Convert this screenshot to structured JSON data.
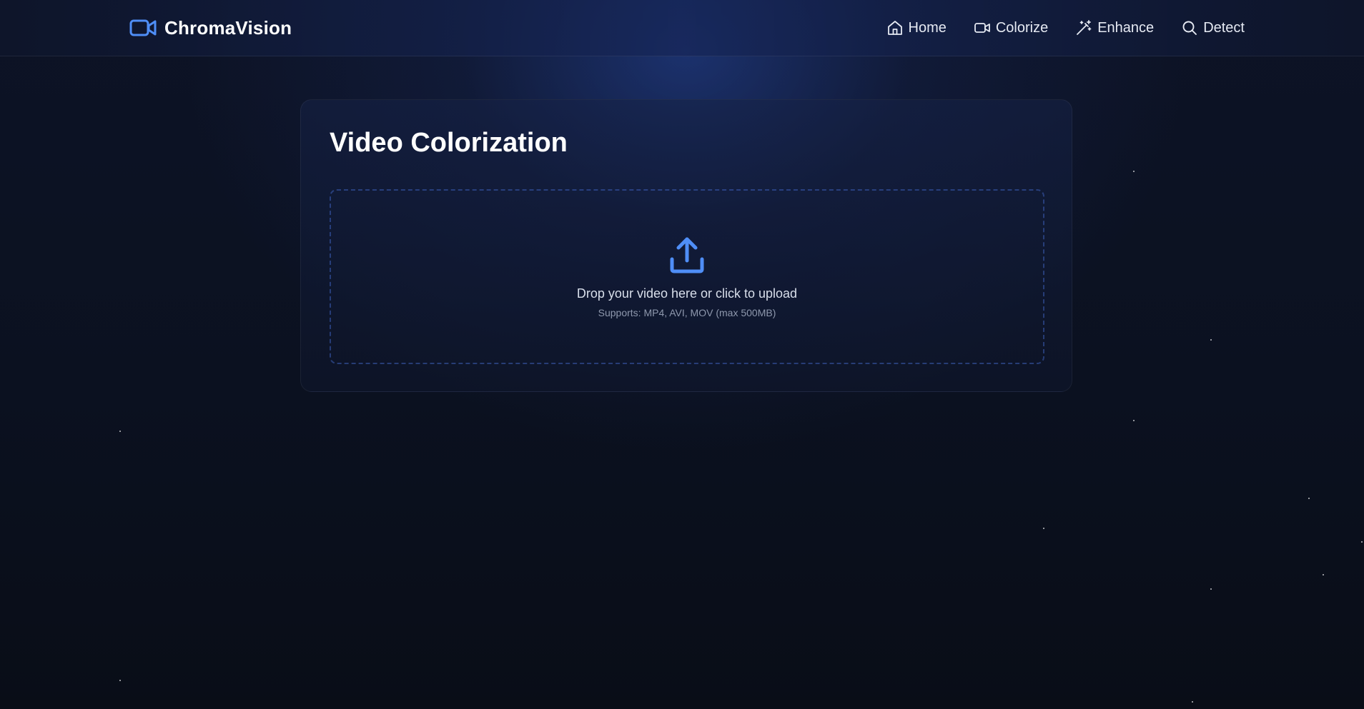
{
  "brand": {
    "name": "ChromaVision",
    "icon": "video-camera-icon",
    "accent_color": "#4f8ef7"
  },
  "nav": {
    "items": [
      {
        "label": "Home",
        "icon": "home-icon"
      },
      {
        "label": "Colorize",
        "icon": "video-camera-icon"
      },
      {
        "label": "Enhance",
        "icon": "magic-wand-icon"
      },
      {
        "label": "Detect",
        "icon": "search-icon"
      }
    ]
  },
  "main": {
    "title": "Video Colorization",
    "upload": {
      "icon": "upload-icon",
      "prompt": "Drop your video here or click to upload",
      "supports": "Supports: MP4, AVI, MOV (max 500MB)"
    }
  },
  "colors": {
    "background": "#0b1120",
    "accent": "#4f8ef7",
    "text_primary": "#ffffff",
    "text_muted": "#8e98ad"
  }
}
